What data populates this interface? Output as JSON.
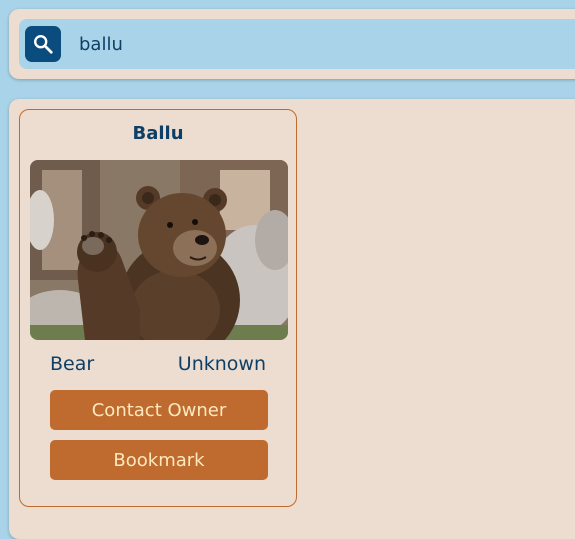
{
  "search": {
    "value": "ballu",
    "icon": "search-icon"
  },
  "results": [
    {
      "name": "Ballu",
      "image": "brown-bear-photo",
      "type": "Bear",
      "owner": "Unknown",
      "contact_label": "Contact Owner",
      "bookmark_label": "Bookmark"
    }
  ],
  "colors": {
    "background": "#a9d3e8",
    "panel": "#ecddd0",
    "accent": "#bf6a2e",
    "button_text": "#fde9bd",
    "text": "#0e3f67",
    "search_button": "#0a4c7d"
  }
}
